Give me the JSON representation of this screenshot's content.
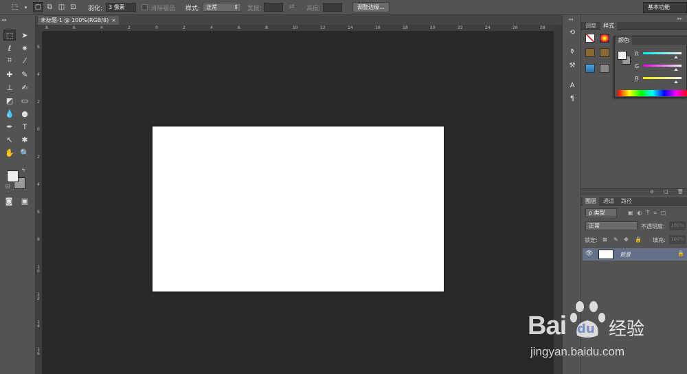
{
  "options_bar": {
    "feather_label": "羽化:",
    "feather_value": "3 像素",
    "antialias_label": "消除锯齿",
    "style_label": "样式:",
    "style_value": "正常",
    "width_label": "宽度:",
    "height_label": "高度:",
    "refine_edge_label": "调整边缘..."
  },
  "workspace": "基本功能",
  "document": {
    "tab_title": "未标题-1 @ 100%(RGB/8)",
    "close": "×",
    "ruler_h": [
      "8",
      "6",
      "4",
      "2",
      "0",
      "2",
      "4",
      "6",
      "8",
      "10",
      "12",
      "14",
      "16",
      "18",
      "20",
      "22",
      "24",
      "26",
      "28"
    ],
    "ruler_v": [
      "6",
      "4",
      "2",
      "0",
      "2",
      "4",
      "6",
      "8",
      "1\n0",
      "1\n2",
      "1\n4",
      "1\n6"
    ]
  },
  "panels": {
    "top_tabs": [
      "调整",
      "样式"
    ],
    "color_tab": "颜色",
    "rgb_labels": [
      "R",
      "G",
      "B"
    ],
    "layers_tabs": [
      "图层",
      "通道",
      "路径"
    ],
    "filter_kind": "ρ 类型",
    "blend_mode": "正常",
    "opacity_label": "不透明度:",
    "opacity_value": "100%",
    "lock_label": "锁定:",
    "fill_label": "填充:",
    "fill_value": "100%",
    "layer_name": "背景"
  },
  "watermark": {
    "brand": "Bai",
    "brand2": "du",
    "suffix": "经验",
    "url": "jingyan.baidu.com"
  },
  "colors": {
    "canvas": "#ffffff",
    "workspace_bg": "#282828",
    "panel_bg": "#535353",
    "layer_selected": "#637087",
    "watermark": "#ffffff"
  }
}
